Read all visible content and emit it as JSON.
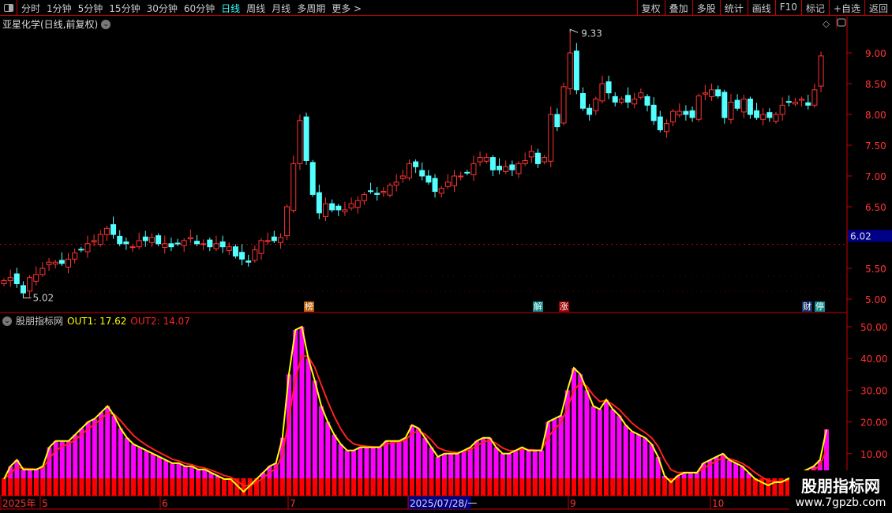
{
  "toolbar": {
    "periods": [
      "分时",
      "1分钟",
      "5分钟",
      "15分钟",
      "30分钟",
      "60分钟",
      "日线",
      "周线",
      "月线",
      "多周期",
      "更多 >"
    ],
    "active": "日线",
    "buttons": [
      "复权",
      "叠加",
      "多股",
      "统计",
      "画线",
      "F10",
      "标记",
      "+自选",
      "返回"
    ]
  },
  "stock_title": "亚星化学(日线,前复权)",
  "indicator": {
    "name": "股朋指标网",
    "out1_label": "OUT1: 17.62",
    "out2_label": "OUT2: 14.07"
  },
  "price_axis": {
    "ticks": [
      "9.00",
      "8.50",
      "8.00",
      "7.50",
      "7.00",
      "6.50",
      "6.00",
      "5.50",
      "5.00"
    ],
    "current": "6.02"
  },
  "indicator_axis": {
    "ticks": [
      "50.00",
      "40.00",
      "30.00",
      "20.00",
      "10.00"
    ]
  },
  "annotations": {
    "high": "9.33",
    "low": "5.02"
  },
  "markers": [
    {
      "text": "榜",
      "color": "#b8600a"
    },
    {
      "text": "解",
      "color": "#0a8a8a"
    },
    {
      "text": "涨",
      "color": "#a00000"
    },
    {
      "text": "财",
      "color": "#103070"
    },
    {
      "text": "停",
      "color": "#0a8a8a"
    }
  ],
  "date_axis": {
    "labels": [
      "2025年",
      "5",
      "6",
      "7",
      "2025/07/28/一",
      "9",
      "10"
    ]
  },
  "watermark": {
    "line1": "股朋指标网",
    "line2": "www.7gpzb.com"
  },
  "colors": {
    "up": "#ff3333",
    "down": "#54ffff",
    "out1": "#ffff00",
    "out2": "#ff2020",
    "bars": "#ff00ff"
  },
  "chart_data": [
    {
      "type": "candlestick",
      "series": "close",
      "values": [
        5.3,
        5.35,
        5.25,
        5.1,
        5.35,
        5.4,
        5.5,
        5.6,
        5.6,
        5.58,
        5.65,
        5.75,
        5.8,
        5.9,
        5.95,
        6.05,
        6.15,
        6.05,
        5.9,
        5.9,
        5.85,
        5.95,
        5.95,
        6.0,
        5.9,
        5.9,
        5.85,
        5.9,
        5.95,
        6.0,
        5.9,
        5.9,
        5.85,
        5.9,
        5.85,
        5.85,
        5.7,
        5.65,
        5.6,
        5.8,
        5.95,
        5.95,
        5.95,
        6.0,
        6.5,
        7.2,
        7.9,
        7.25,
        6.7,
        6.4,
        6.55,
        6.45,
        6.45,
        6.45,
        6.55,
        6.6,
        6.7,
        6.75,
        6.7,
        6.75,
        6.85,
        6.9,
        7.0,
        7.2,
        7.15,
        7.0,
        6.9,
        6.75,
        6.8,
        6.9,
        7.0,
        7.0,
        7.05,
        7.2,
        7.3,
        7.3,
        7.1,
        7.1,
        7.15,
        7.1,
        7.2,
        7.25,
        7.4,
        7.2,
        7.3,
        8.0,
        7.8,
        8.45,
        9.0,
        8.4,
        8.1,
        8.0,
        8.25,
        8.5,
        8.35,
        8.2,
        8.25,
        8.2,
        8.25,
        8.35,
        8.15,
        7.9,
        7.75,
        7.85,
        8.05,
        8.05,
        8.0,
        7.95,
        8.3,
        8.35,
        8.4,
        8.3,
        7.95,
        8.2,
        8.1,
        8.25,
        8.0,
        7.95,
        8.0,
        7.95,
        8.0,
        8.15,
        8.2,
        8.2,
        8.25,
        8.15,
        8.4,
        8.95
      ],
      "ylim": [
        4.85,
        9.6
      ],
      "high": 9.33,
      "low": 5.02
    },
    {
      "type": "bar+line",
      "series": "OUT1",
      "values": [
        2,
        6,
        8,
        5,
        5,
        5,
        6,
        12,
        14,
        14,
        14,
        16,
        18,
        20,
        21,
        23,
        25,
        22,
        18,
        15,
        13,
        12,
        11,
        10,
        9,
        8,
        7,
        7,
        6,
        6,
        5,
        5,
        4,
        3,
        2,
        2,
        0,
        -2,
        0,
        2,
        4,
        6,
        7,
        15,
        35,
        49,
        50,
        40,
        33,
        25,
        20,
        16,
        13,
        11,
        11,
        12,
        12,
        12,
        12,
        14,
        14,
        14,
        15,
        19,
        18,
        15,
        12,
        9,
        10,
        10,
        10,
        11,
        12,
        14,
        15,
        15,
        12,
        10,
        10,
        11,
        12,
        11,
        11,
        11,
        20,
        21,
        22,
        30,
        37,
        35,
        30,
        25,
        24,
        27,
        24,
        22,
        19,
        17,
        16,
        15,
        13,
        9,
        3,
        1,
        3,
        4,
        4,
        4,
        7,
        8,
        9,
        10,
        8,
        7,
        6,
        4,
        2,
        1,
        0,
        1,
        1,
        2,
        3,
        4,
        5,
        6,
        8,
        17.62
      ],
      "ylim": [
        -3.5,
        53
      ]
    }
  ]
}
